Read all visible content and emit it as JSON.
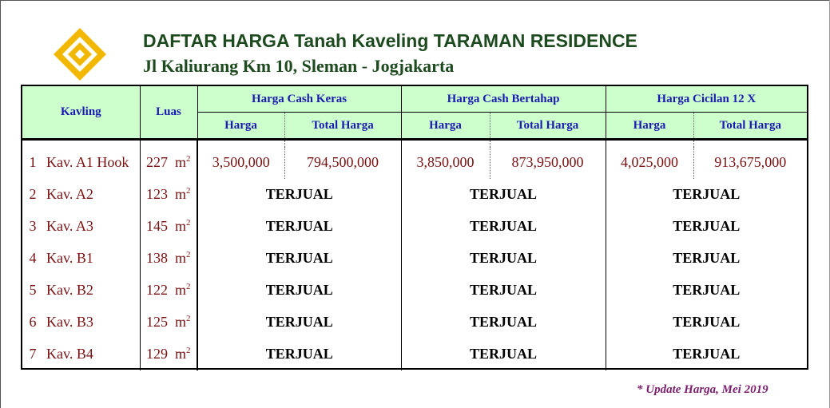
{
  "header": {
    "title": "DAFTAR HARGA Tanah Kaveling TARAMAN RESIDENCE",
    "subtitle": "Jl Kaliurang Km 10, Sleman - Jogjakarta"
  },
  "table": {
    "col_kavling": "Kavling",
    "col_luas": "Luas",
    "groups": [
      "Harga Cash Keras",
      "Harga Cash Bertahap",
      "Harga Cicilan 12 X"
    ],
    "sub_harga": "Harga",
    "sub_total": "Total Harga",
    "unit": "m",
    "unit_power": "2",
    "rows": [
      {
        "no": "1",
        "kavling": "Kav. A1 Hook",
        "luas": "227",
        "cash_harga": "3,500,000",
        "cash_total": "794,500,000",
        "bertahap_harga": "3,850,000",
        "bertahap_total": "873,950,000",
        "cicilan_harga": "4,025,000",
        "cicilan_total": "913,675,000"
      },
      {
        "no": "2",
        "kavling": "Kav. A2",
        "luas": "123",
        "status": "TERJUAL"
      },
      {
        "no": "3",
        "kavling": "Kav. A3",
        "luas": "145",
        "status": "TERJUAL"
      },
      {
        "no": "4",
        "kavling": "Kav. B1",
        "luas": "138",
        "status": "TERJUAL"
      },
      {
        "no": "5",
        "kavling": "Kav. B2",
        "luas": "122",
        "status": "TERJUAL"
      },
      {
        "no": "6",
        "kavling": "Kav. B3",
        "luas": "125",
        "status": "TERJUAL"
      },
      {
        "no": "7",
        "kavling": "Kav. B4",
        "luas": "129",
        "status": "TERJUAL"
      }
    ]
  },
  "note": "* Update Harga, Mei 2019",
  "colors": {
    "title": "#1d4a1f",
    "header_bg": "#ccffcc",
    "header_text": "#1a1ab0",
    "cell_text": "#7a1010",
    "logo": "#f2b800"
  },
  "icons": {
    "logo": "diamond-logo-icon"
  }
}
